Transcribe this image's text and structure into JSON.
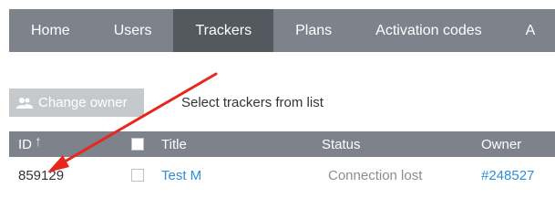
{
  "nav": {
    "items": [
      {
        "label": "Home"
      },
      {
        "label": "Users"
      },
      {
        "label": "Trackers"
      },
      {
        "label": "Plans"
      },
      {
        "label": "Activation codes"
      },
      {
        "label": "A"
      }
    ],
    "active_index": 2,
    "bg_color": "#7d828b",
    "active_color": "#545960"
  },
  "toolbar": {
    "change_owner_label": "Change owner",
    "change_owner_icon": "users-icon",
    "hint": "Select trackers from list"
  },
  "table": {
    "columns": {
      "id": "ID",
      "title": "Title",
      "status": "Status",
      "owner": "Owner"
    },
    "sort_icon": "arrow-up-icon",
    "rows": [
      {
        "id": "859129",
        "title": "Test M",
        "status": "Connection lost",
        "owner": "#248527"
      }
    ]
  },
  "annotation": {
    "type": "red-arrow",
    "color": "#e8261c"
  }
}
